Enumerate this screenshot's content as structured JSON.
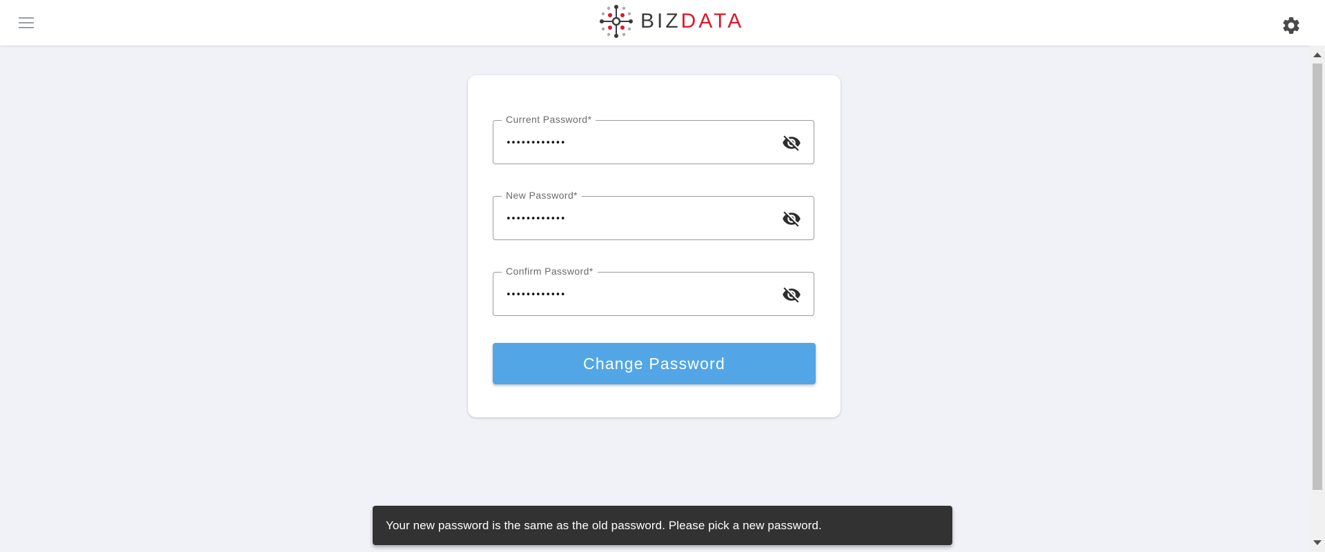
{
  "header": {
    "logo": {
      "word_left": "BIZ",
      "word_right": "DATA"
    },
    "icons": {
      "menu": "hamburger-menu-icon",
      "settings": "gear-icon"
    }
  },
  "form": {
    "fields": [
      {
        "label": "Current Password*",
        "value": "••••••••••••",
        "toggle_icon": "eye-off-icon"
      },
      {
        "label": "New Password*",
        "value": "••••••••••••",
        "toggle_icon": "eye-off-icon"
      },
      {
        "label": "Confirm Password*",
        "value": "••••••••••••",
        "toggle_icon": "eye-off-icon"
      }
    ],
    "submit_label": "Change Password"
  },
  "snackbar": {
    "message": "Your new password is the same as the old password. Please pick a new password."
  },
  "colors": {
    "accent": "#52a6e6",
    "brand_red": "#e0162b",
    "brand_dark": "#3a3a3a",
    "page_bg": "#f1f2f7",
    "snackbar_bg": "#323232"
  }
}
